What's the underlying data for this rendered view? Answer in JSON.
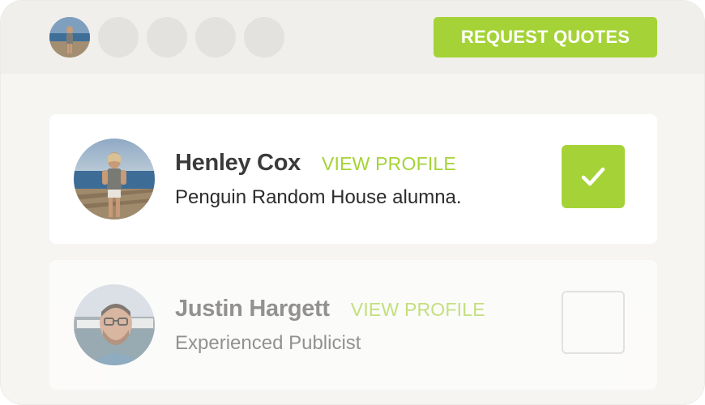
{
  "header": {
    "request_button_label": "REQUEST QUOTES",
    "selected_avatar_count": 1,
    "empty_slot_count": 4
  },
  "candidates": [
    {
      "name": "Henley Cox",
      "view_profile_label": "VIEW PROFILE",
      "description": "Penguin Random House alumna.",
      "selected": true
    },
    {
      "name": "Justin Hargett",
      "view_profile_label": "VIEW PROFILE",
      "description": "Experienced Publicist",
      "selected": false
    }
  ],
  "colors": {
    "accent": "#a5d337",
    "background": "#f6f5f2",
    "header_bg": "#f1efeb",
    "placeholder": "#e4e2de"
  },
  "icons": {
    "check": "checkmark-icon"
  }
}
